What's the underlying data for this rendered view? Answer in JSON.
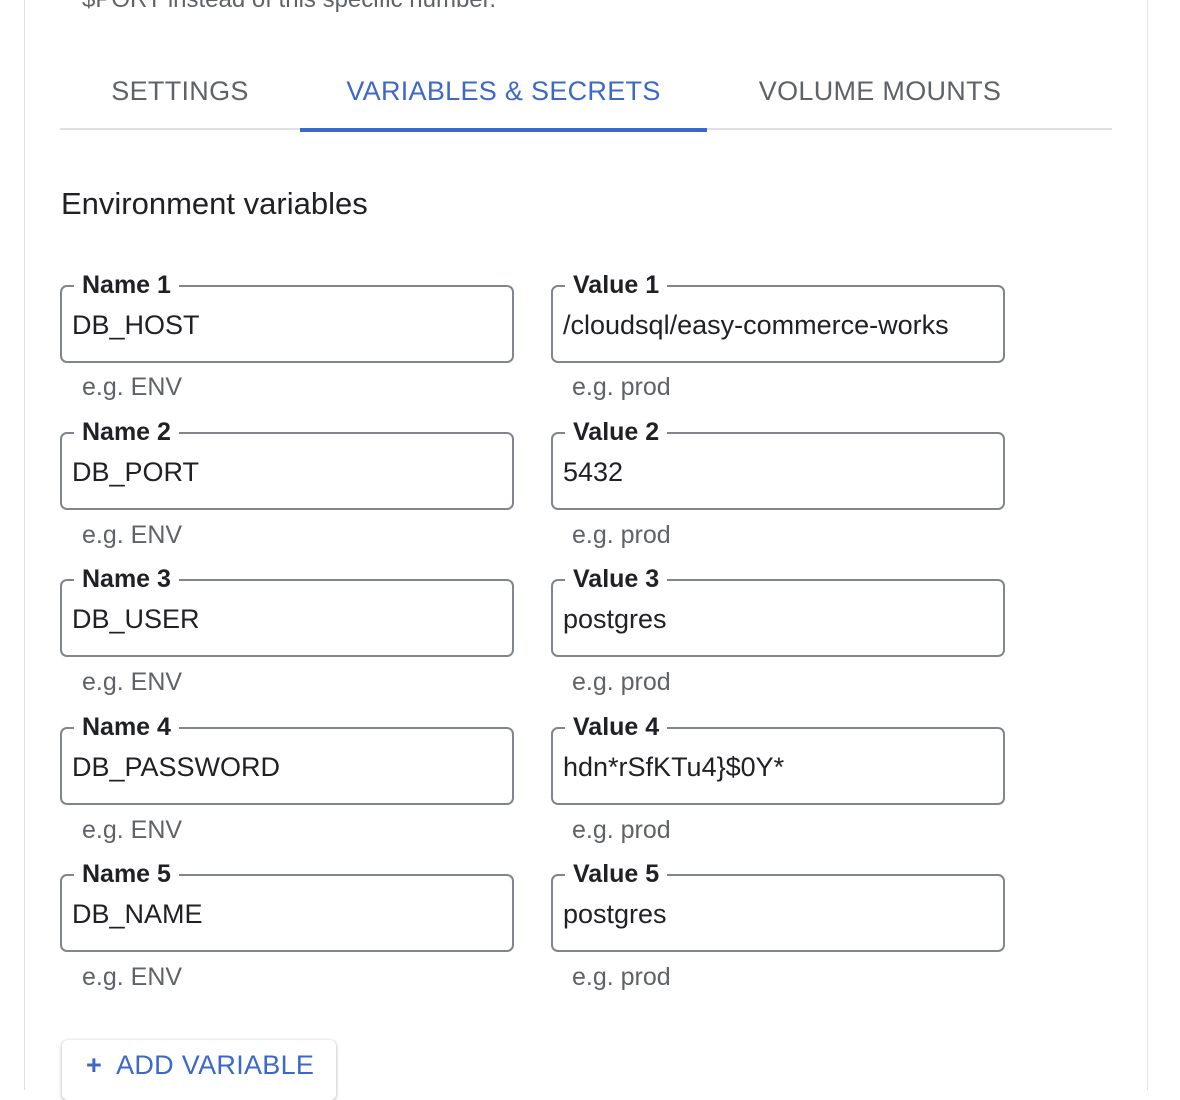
{
  "clipped_hint": "$PORT instead of this specific number.",
  "tabs": [
    {
      "label": "SETTINGS",
      "active": false
    },
    {
      "label": "VARIABLES & SECRETS",
      "active": true
    },
    {
      "label": "VOLUME MOUNTS",
      "active": false
    }
  ],
  "section_title": "Environment variables",
  "name_hint": "e.g. ENV",
  "value_hint": "e.g. prod",
  "variables": [
    {
      "name_label": "Name 1",
      "name": "DB_HOST",
      "value_label": "Value 1",
      "value": "/cloudsql/easy-commerce-works"
    },
    {
      "name_label": "Name 2",
      "name": "DB_PORT",
      "value_label": "Value 2",
      "value": "5432"
    },
    {
      "name_label": "Name 3",
      "name": "DB_USER",
      "value_label": "Value 3",
      "value": "postgres"
    },
    {
      "name_label": "Name 4",
      "name": "DB_PASSWORD",
      "value_label": "Value 4",
      "value": "hdn*rSfKTu4}$0Y*"
    },
    {
      "name_label": "Name 5",
      "name": "DB_NAME",
      "value_label": "Value 5",
      "value": "postgres"
    }
  ],
  "add_button": {
    "icon": "plus-icon",
    "label": "ADD VARIABLE"
  },
  "colors": {
    "accent": "#3c68c9",
    "border": "#80868b",
    "muted": "#5f6368"
  }
}
